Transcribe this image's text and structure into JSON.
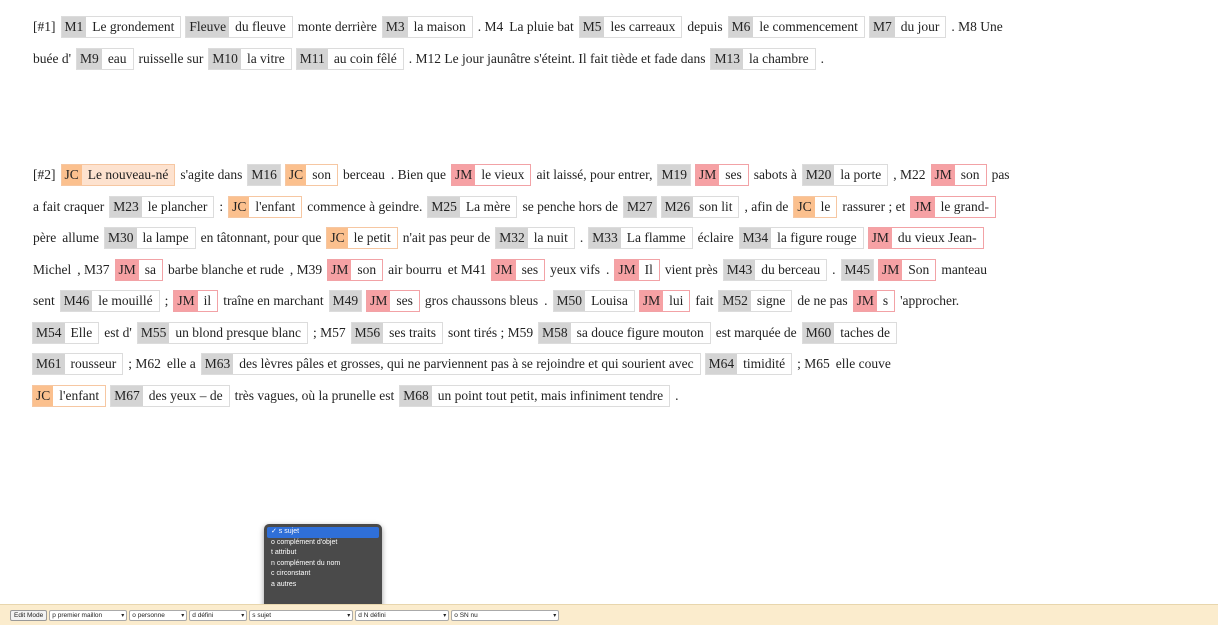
{
  "colors": {
    "jc": "#fbc08e",
    "jm": "#f6a1a4",
    "tag": "#d4d4d4",
    "toolbar": "#fbeccd",
    "selected_option": "#2f6fd8"
  },
  "paragraphs": [
    {
      "lines": [
        [
          {
            "t": "p",
            "text": "[#1]"
          },
          {
            "t": "m",
            "tag": "M1",
            "text": "Le grondement"
          },
          {
            "t": "m",
            "tag": "Fleuve",
            "text": "du fleuve"
          },
          {
            "t": "p",
            "text": "monte derrière"
          },
          {
            "t": "m",
            "tag": "M3",
            "text": "la maison"
          },
          {
            "t": "p",
            "text": ". M4"
          },
          {
            "t": "p",
            "text": "La pluie   bat"
          },
          {
            "t": "m",
            "tag": "M5",
            "text": "les carreaux"
          },
          {
            "t": "p",
            "text": "depuis"
          },
          {
            "t": "m",
            "tag": "M6",
            "text": "le commencement"
          },
          {
            "t": "m",
            "tag": "M7",
            "text": "du jour"
          },
          {
            "t": "p",
            "text": ". M8  Une"
          }
        ],
        [
          {
            "t": "p",
            "text": "buée d'"
          },
          {
            "t": "m",
            "tag": "M9",
            "text": "eau"
          },
          {
            "t": "p",
            "text": "ruisselle sur"
          },
          {
            "t": "m",
            "tag": "M10",
            "text": "la vitre"
          },
          {
            "t": "m",
            "tag": "M11",
            "text": "au coin fêlé"
          },
          {
            "t": "p",
            "text": ". M12  Le jour jaunâtre   s'éteint. Il fait tiède et fade dans"
          },
          {
            "t": "m",
            "tag": "M13",
            "text": "la chambre"
          },
          {
            "t": "p",
            "text": "."
          }
        ]
      ]
    },
    {
      "lines": [
        [
          {
            "t": "p",
            "text": "[#2]"
          },
          {
            "t": "m",
            "tag": "JC",
            "text": "Le nouveau-né",
            "cls": "jc-fill"
          },
          {
            "t": "p",
            "text": "s'agite dans"
          },
          {
            "t": "m",
            "tag": "M16",
            "text": ""
          },
          {
            "t": "m",
            "tag": "JC",
            "text": "son",
            "cls": "jc"
          },
          {
            "t": "p",
            "text": "berceau"
          },
          {
            "t": "p",
            "text": ". Bien que"
          },
          {
            "t": "m",
            "tag": "JM",
            "text": "le vieux",
            "cls": "jm"
          },
          {
            "t": "p",
            "text": "ait laissé, pour entrer,"
          },
          {
            "t": "m",
            "tag": "M19",
            "text": ""
          },
          {
            "t": "m",
            "tag": "JM",
            "text": "ses",
            "cls": "jm"
          },
          {
            "t": "p",
            "text": "sabots   à"
          },
          {
            "t": "m",
            "tag": "M20",
            "text": "la porte"
          },
          {
            "t": "p",
            "text": ", M22"
          },
          {
            "t": "m",
            "tag": "JM",
            "text": "son",
            "cls": "jm"
          },
          {
            "t": "p",
            "text": "pas"
          }
        ],
        [
          {
            "t": "p",
            "text": "a fait craquer"
          },
          {
            "t": "m",
            "tag": "M23",
            "text": "le plancher"
          },
          {
            "t": "p",
            "text": ":"
          },
          {
            "t": "m",
            "tag": "JC",
            "text": "l'enfant",
            "cls": "jc"
          },
          {
            "t": "p",
            "text": "commence à geindre."
          },
          {
            "t": "m",
            "tag": "M25",
            "text": "La mère"
          },
          {
            "t": "p",
            "text": "se penche hors de"
          },
          {
            "t": "m",
            "tag": "M27",
            "text": ""
          },
          {
            "t": "m",
            "tag": "M26",
            "text": "son   lit"
          },
          {
            "t": "p",
            "text": ", afin de"
          },
          {
            "t": "m",
            "tag": "JC",
            "text": "le",
            "cls": "jc"
          },
          {
            "t": "p",
            "text": "rassurer ; et"
          },
          {
            "t": "m",
            "tag": "JM",
            "text": "le grand-",
            "cls": "jm"
          }
        ],
        [
          {
            "t": "p",
            "text": "père"
          },
          {
            "t": "p",
            "text": "allume"
          },
          {
            "t": "m",
            "tag": "M30",
            "text": "la lampe"
          },
          {
            "t": "p",
            "text": "en tâtonnant, pour que"
          },
          {
            "t": "m",
            "tag": "JC",
            "text": "le petit",
            "cls": "jc"
          },
          {
            "t": "p",
            "text": "n'ait pas peur de"
          },
          {
            "t": "m",
            "tag": "M32",
            "text": "la nuit"
          },
          {
            "t": "p",
            "text": "."
          },
          {
            "t": "m",
            "tag": "M33",
            "text": "La flamme"
          },
          {
            "t": "p",
            "text": "éclaire"
          },
          {
            "t": "m",
            "tag": "M34",
            "text": "la figure rouge"
          },
          {
            "t": "m",
            "tag": "JM",
            "text": "du vieux Jean-",
            "cls": "jm"
          }
        ],
        [
          {
            "t": "p",
            "text": "Michel"
          },
          {
            "t": "p",
            "text": ", M37"
          },
          {
            "t": "m",
            "tag": "JM",
            "text": "sa",
            "cls": "jm"
          },
          {
            "t": "p",
            "text": "barbe blanche et rude"
          },
          {
            "t": "p",
            "text": ", M39"
          },
          {
            "t": "m",
            "tag": "JM",
            "text": "son",
            "cls": "jm"
          },
          {
            "t": "p",
            "text": "air bourru"
          },
          {
            "t": "p",
            "text": "et M41"
          },
          {
            "t": "m",
            "tag": "JM",
            "text": "ses",
            "cls": "jm"
          },
          {
            "t": "p",
            "text": "yeux vifs"
          },
          {
            "t": "p",
            "text": "."
          },
          {
            "t": "m",
            "tag": "JM",
            "text": "Il",
            "cls": "jm"
          },
          {
            "t": "p",
            "text": "vient près"
          },
          {
            "t": "m",
            "tag": "M43",
            "text": "du berceau"
          },
          {
            "t": "p",
            "text": "."
          },
          {
            "t": "m",
            "tag": "M45",
            "text": ""
          },
          {
            "t": "m",
            "tag": "JM",
            "text": "Son",
            "cls": "jm"
          },
          {
            "t": "p",
            "text": "manteau"
          }
        ],
        [
          {
            "t": "p",
            "text": "sent"
          },
          {
            "t": "m",
            "tag": "M46",
            "text": "le mouillé"
          },
          {
            "t": "p",
            "text": ";"
          },
          {
            "t": "m",
            "tag": "JM",
            "text": "il",
            "cls": "jm"
          },
          {
            "t": "p",
            "text": "traîne en marchant"
          },
          {
            "t": "m",
            "tag": "M49",
            "text": ""
          },
          {
            "t": "m",
            "tag": "JM",
            "text": "ses",
            "cls": "jm"
          },
          {
            "t": "p",
            "text": "gros chaussons bleus"
          },
          {
            "t": "p",
            "text": "."
          },
          {
            "t": "m",
            "tag": "M50",
            "text": "Louisa"
          },
          {
            "t": "m",
            "tag": "JM",
            "text": "lui",
            "cls": "jm"
          },
          {
            "t": "p",
            "text": "fait"
          },
          {
            "t": "m",
            "tag": "M52",
            "text": "signe"
          },
          {
            "t": "p",
            "text": "de ne pas"
          },
          {
            "t": "m",
            "tag": "JM",
            "text": "s",
            "cls": "jm"
          },
          {
            "t": "p",
            "text": "'approcher."
          }
        ],
        [
          {
            "t": "m",
            "tag": "M54",
            "text": "Elle"
          },
          {
            "t": "p",
            "text": "est d'"
          },
          {
            "t": "m",
            "tag": "M55",
            "text": "un blond presque blanc"
          },
          {
            "t": "p",
            "text": "; M57"
          },
          {
            "t": "m",
            "tag": "M56",
            "text": "ses   traits"
          },
          {
            "t": "p",
            "text": "sont tirés ; M59"
          },
          {
            "t": "m",
            "tag": "M58",
            "text": "sa   douce figure mouton"
          },
          {
            "t": "p",
            "text": "est marquée de"
          },
          {
            "t": "m",
            "tag": "M60",
            "text": "taches de"
          }
        ],
        [
          {
            "t": "m",
            "tag": "M61",
            "text": "rousseur"
          },
          {
            "t": "p",
            "text": "; M62"
          },
          {
            "t": "p",
            "text": "elle   a"
          },
          {
            "t": "m",
            "tag": "M63",
            "text": "des lèvres pâles et grosses, qui ne parviennent pas à se rejoindre et qui sourient avec"
          },
          {
            "t": "m",
            "tag": "M64",
            "text": "timidité"
          },
          {
            "t": "p",
            "text": "; M65"
          },
          {
            "t": "p",
            "text": "elle   couve"
          }
        ],
        [
          {
            "t": "m",
            "tag": "JC",
            "text": "l'enfant",
            "cls": "jc"
          },
          {
            "t": "m",
            "tag": "M67",
            "text": "des yeux – de"
          },
          {
            "t": "p",
            "text": "très vagues, où la prunelle est"
          },
          {
            "t": "m",
            "tag": "M68",
            "text": "un point tout petit, mais infiniment tendre"
          },
          {
            "t": "p",
            "text": "."
          }
        ]
      ]
    }
  ],
  "role_popup": {
    "options": [
      {
        "label": "✓ s sujet",
        "selected": true
      },
      {
        "label": "o complément d'objet",
        "selected": false
      },
      {
        "label": "t attribut",
        "selected": false
      },
      {
        "label": "n complément du nom",
        "selected": false
      },
      {
        "label": "c circonstant",
        "selected": false
      },
      {
        "label": "a autres",
        "selected": false
      }
    ]
  },
  "toolbar": {
    "button": "Edit Mode",
    "selects": [
      "p premier maillon",
      "o personne",
      "d défini",
      "s sujet",
      "d N défini",
      "o SN nu"
    ]
  }
}
